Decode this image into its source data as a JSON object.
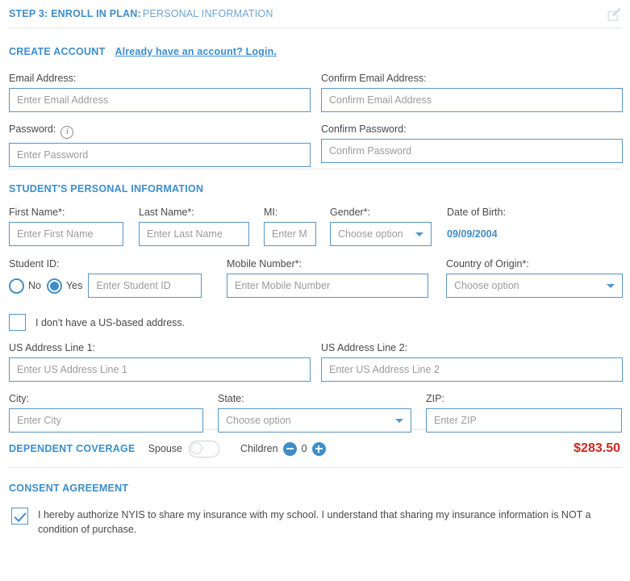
{
  "header": {
    "step_strong": "STEP 3: ENROLL IN PLAN:",
    "step_light": "PERSONAL INFORMATION",
    "edit_icon": "edit-square-icon"
  },
  "create_account": {
    "title": "CREATE ACCOUNT",
    "login_link": "Already have an account? Login.",
    "email_label": "Email Address:",
    "email_placeholder": "Enter Email Address",
    "confirm_email_label": "Confirm Email Address:",
    "confirm_email_placeholder": "Confirm Email Address",
    "password_label": "Password:",
    "password_info_icon": "info-circle-icon",
    "password_placeholder": "Enter Password",
    "confirm_password_label": "Confirm Password:",
    "confirm_password_placeholder": "Confirm Password"
  },
  "student_info": {
    "title": "STUDENT'S PERSONAL INFORMATION",
    "first_name_label": "First Name*:",
    "first_name_placeholder": "Enter First Name",
    "last_name_label": "Last Name*:",
    "last_name_placeholder": "Enter Last Name",
    "mi_label": "MI:",
    "mi_placeholder": "Enter MI",
    "gender_label": "Gender*:",
    "gender_value": "Choose option",
    "dob_label": "Date of Birth:",
    "dob_value": "09/09/2004",
    "student_id_label": "Student ID:",
    "student_id_no": "No",
    "student_id_yes": "Yes",
    "student_id_selected": "Yes",
    "student_id_placeholder": "Enter Student ID",
    "mobile_label": "Mobile Number*:",
    "mobile_placeholder": "Enter Mobile Number",
    "country_label": "Country of Origin*:",
    "country_value": "Choose option",
    "no_us_address_label": "I don't have a US-based address.",
    "no_us_address_checked": false,
    "address1_label": "US Address Line 1:",
    "address1_placeholder": "Enter US Address Line 1",
    "address2_label": "US Address Line 2:",
    "address2_placeholder": "Enter US Address Line 2",
    "city_label": "City:",
    "city_placeholder": "Enter City",
    "state_label": "State:",
    "state_value": "Choose option",
    "zip_label": "ZIP:",
    "zip_placeholder": "Enter ZIP"
  },
  "dependent_coverage": {
    "title": "DEPENDENT COVERAGE",
    "spouse_label": "Spouse",
    "spouse_on": false,
    "children_label": "Children",
    "children_count": "0",
    "decrement_icon": "minus-circle-icon",
    "increment_icon": "plus-circle-icon",
    "price": "$283.50"
  },
  "consent": {
    "title": "CONSENT AGREEMENT",
    "checked": true,
    "text": "I hereby authorize NYIS to share my insurance with my school. I understand that sharing my insurance information is NOT a condition of purchase."
  },
  "colors": {
    "accent_blue": "#3d8ecb",
    "border_blue": "#5a95c4",
    "price_red": "#d0281e",
    "text_gray": "#4a4a4a",
    "placeholder_gray": "#9b9b9b"
  }
}
